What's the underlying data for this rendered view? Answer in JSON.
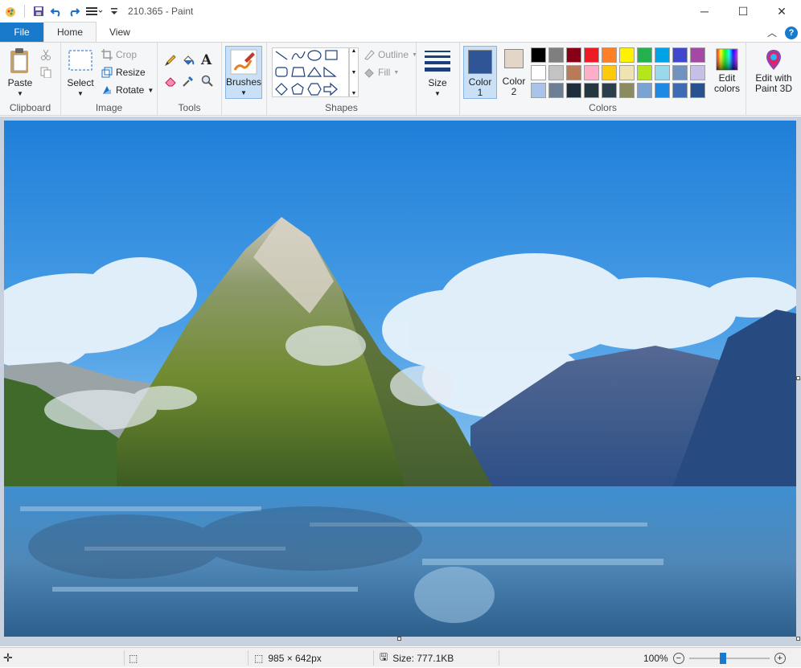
{
  "window": {
    "title": "210.365 - Paint"
  },
  "tabs": {
    "file": "File",
    "home": "Home",
    "view": "View"
  },
  "clipboard": {
    "paste": "Paste",
    "label": "Clipboard"
  },
  "image_group": {
    "select": "Select",
    "crop": "Crop",
    "resize": "Resize",
    "rotate": "Rotate",
    "label": "Image"
  },
  "tools": {
    "label": "Tools"
  },
  "brushes": {
    "label": "Brushes"
  },
  "shapes": {
    "outline": "Outline",
    "fill": "Fill",
    "label": "Shapes"
  },
  "size": {
    "label": "Size"
  },
  "colors": {
    "color1": "Color 1",
    "color2": "Color 2",
    "color1_value": "#2f5597",
    "color2_value": "#e3d6c9",
    "edit": "Edit colors",
    "label": "Colors",
    "palette_row1": [
      "#000000",
      "#7f7f7f",
      "#880015",
      "#ed1c24",
      "#ff7f27",
      "#fff200",
      "#22b14c",
      "#00a2e8",
      "#3f48cc",
      "#a349a4"
    ],
    "palette_row2": [
      "#ffffff",
      "#c3c3c3",
      "#b97a57",
      "#ffaec9",
      "#ffc90e",
      "#efe4b0",
      "#b5e61d",
      "#99d9ea",
      "#7092be",
      "#c8bfe7"
    ],
    "palette_row3": [
      "#a9c4e8",
      "#6d7d93",
      "#1e2e3d",
      "#263640",
      "#2c3e4c",
      "#8b8b5f",
      "#7aa3d4",
      "#1e88e5",
      "#3f6bb5",
      "#28528f"
    ]
  },
  "paint3d": {
    "label": "Edit with Paint 3D"
  },
  "status": {
    "dimensions": "985 × 642px",
    "size": "Size: 777.1KB",
    "zoom": "100%"
  }
}
